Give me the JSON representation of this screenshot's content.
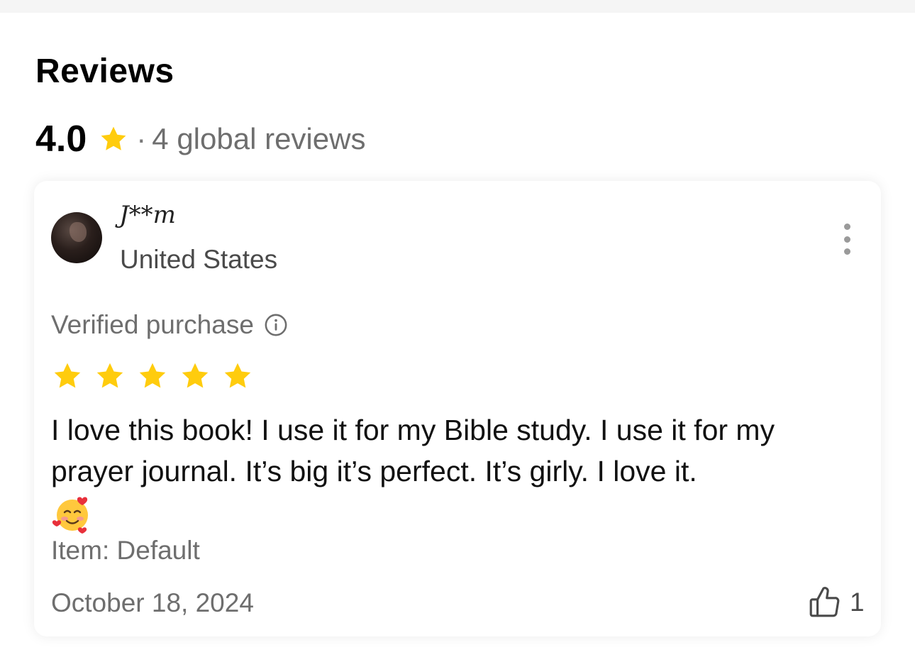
{
  "reviews": {
    "title": "Reviews",
    "average_rating": "4.0",
    "separator": "·",
    "count_label": "4 global reviews",
    "star_color": "#FFCC0D"
  },
  "review": {
    "reviewer_name": "J**m",
    "reviewer_country": "United States",
    "verified_label": "Verified purchase",
    "stars": 5,
    "text": "I love this book! I use it for my Bible study. I use it for my prayer journal. It’s big it’s perfect. It’s girly. I love it.",
    "emoji": "smiling-face-with-hearts",
    "item_variant": "Item: Default",
    "date": "October 18, 2024",
    "helpful_count": "1"
  },
  "icons": {
    "star": "star-icon",
    "info": "info-icon",
    "more": "more-vertical-icon",
    "thumb": "thumbs-up-icon"
  }
}
